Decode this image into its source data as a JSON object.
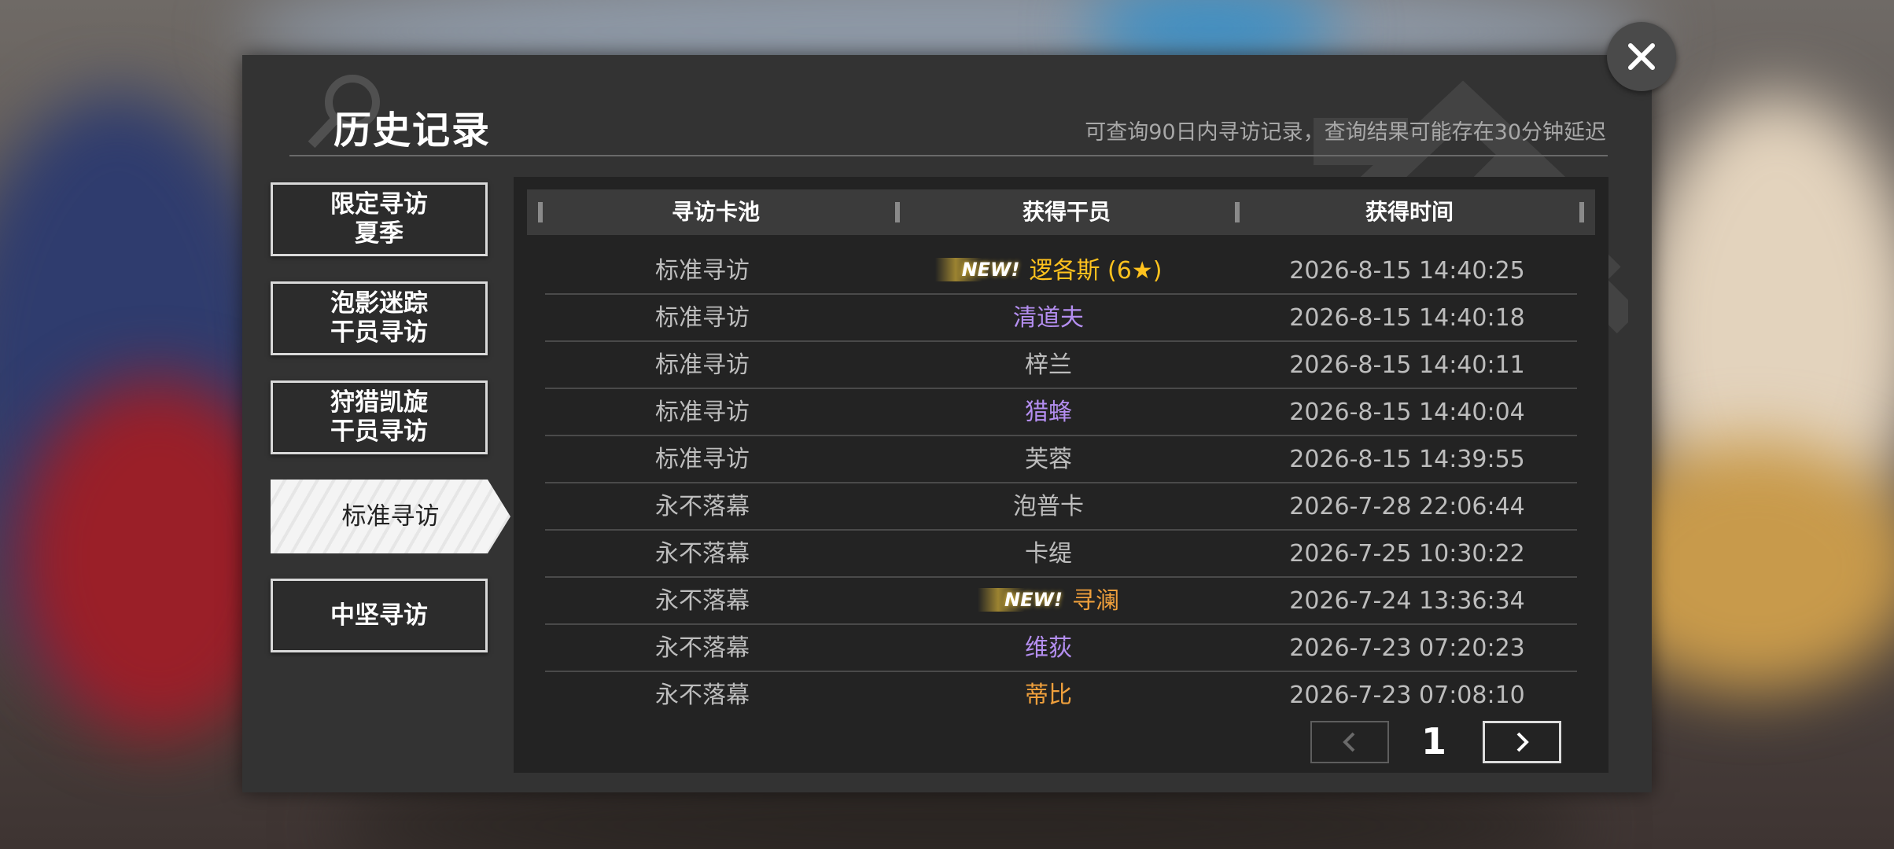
{
  "header": {
    "title": "历史记录",
    "notice": "可查询90日内寻访记录，查询结果可能存在30分钟延迟"
  },
  "sidebar": {
    "items": [
      {
        "line1": "限定寻访",
        "line2": "夏季",
        "active": false
      },
      {
        "line1": "泡影迷踪",
        "line2": "干员寻访",
        "active": false
      },
      {
        "line1": "狩猎凯旋",
        "line2": "干员寻访",
        "active": false
      },
      {
        "line1": "标准寻访",
        "line2": "",
        "active": true
      },
      {
        "line1": "中坚寻访",
        "line2": "",
        "active": false
      }
    ]
  },
  "table": {
    "headers": [
      "寻访卡池",
      "获得干员",
      "获得时间"
    ],
    "new_label": "NEW!",
    "rows": [
      {
        "pool": "标准寻访",
        "operator": "逻各斯 (6★)",
        "time": "2026-8-15 14:40:25",
        "new": true,
        "color": "#ffc21e"
      },
      {
        "pool": "标准寻访",
        "operator": "清道夫",
        "time": "2026-8-15 14:40:18",
        "new": false,
        "color": "#b48ef0"
      },
      {
        "pool": "标准寻访",
        "operator": "梓兰",
        "time": "2026-8-15 14:40:11",
        "new": false,
        "color": "#bdbdbd"
      },
      {
        "pool": "标准寻访",
        "operator": "猎蜂",
        "time": "2026-8-15 14:40:04",
        "new": false,
        "color": "#b48ef0"
      },
      {
        "pool": "标准寻访",
        "operator": "芙蓉",
        "time": "2026-8-15 14:39:55",
        "new": false,
        "color": "#bdbdbd"
      },
      {
        "pool": "永不落幕",
        "operator": "泡普卡",
        "time": "2026-7-28 22:06:44",
        "new": false,
        "color": "#bdbdbd"
      },
      {
        "pool": "永不落幕",
        "operator": "卡缇",
        "time": "2026-7-25 10:30:22",
        "new": false,
        "color": "#bdbdbd"
      },
      {
        "pool": "永不落幕",
        "operator": "寻澜",
        "time": "2026-7-24 13:36:34",
        "new": true,
        "color": "#f0a03c"
      },
      {
        "pool": "永不落幕",
        "operator": "维荻",
        "time": "2026-7-23 07:20:23",
        "new": false,
        "color": "#b48ef0"
      },
      {
        "pool": "永不落幕",
        "operator": "蒂比",
        "time": "2026-7-23 07:08:10",
        "new": false,
        "color": "#f0a03c"
      }
    ]
  },
  "pagination": {
    "current": "1"
  },
  "icons": {
    "close": "close-icon",
    "prev": "chevron-left-icon",
    "next": "chevron-right-icon"
  }
}
